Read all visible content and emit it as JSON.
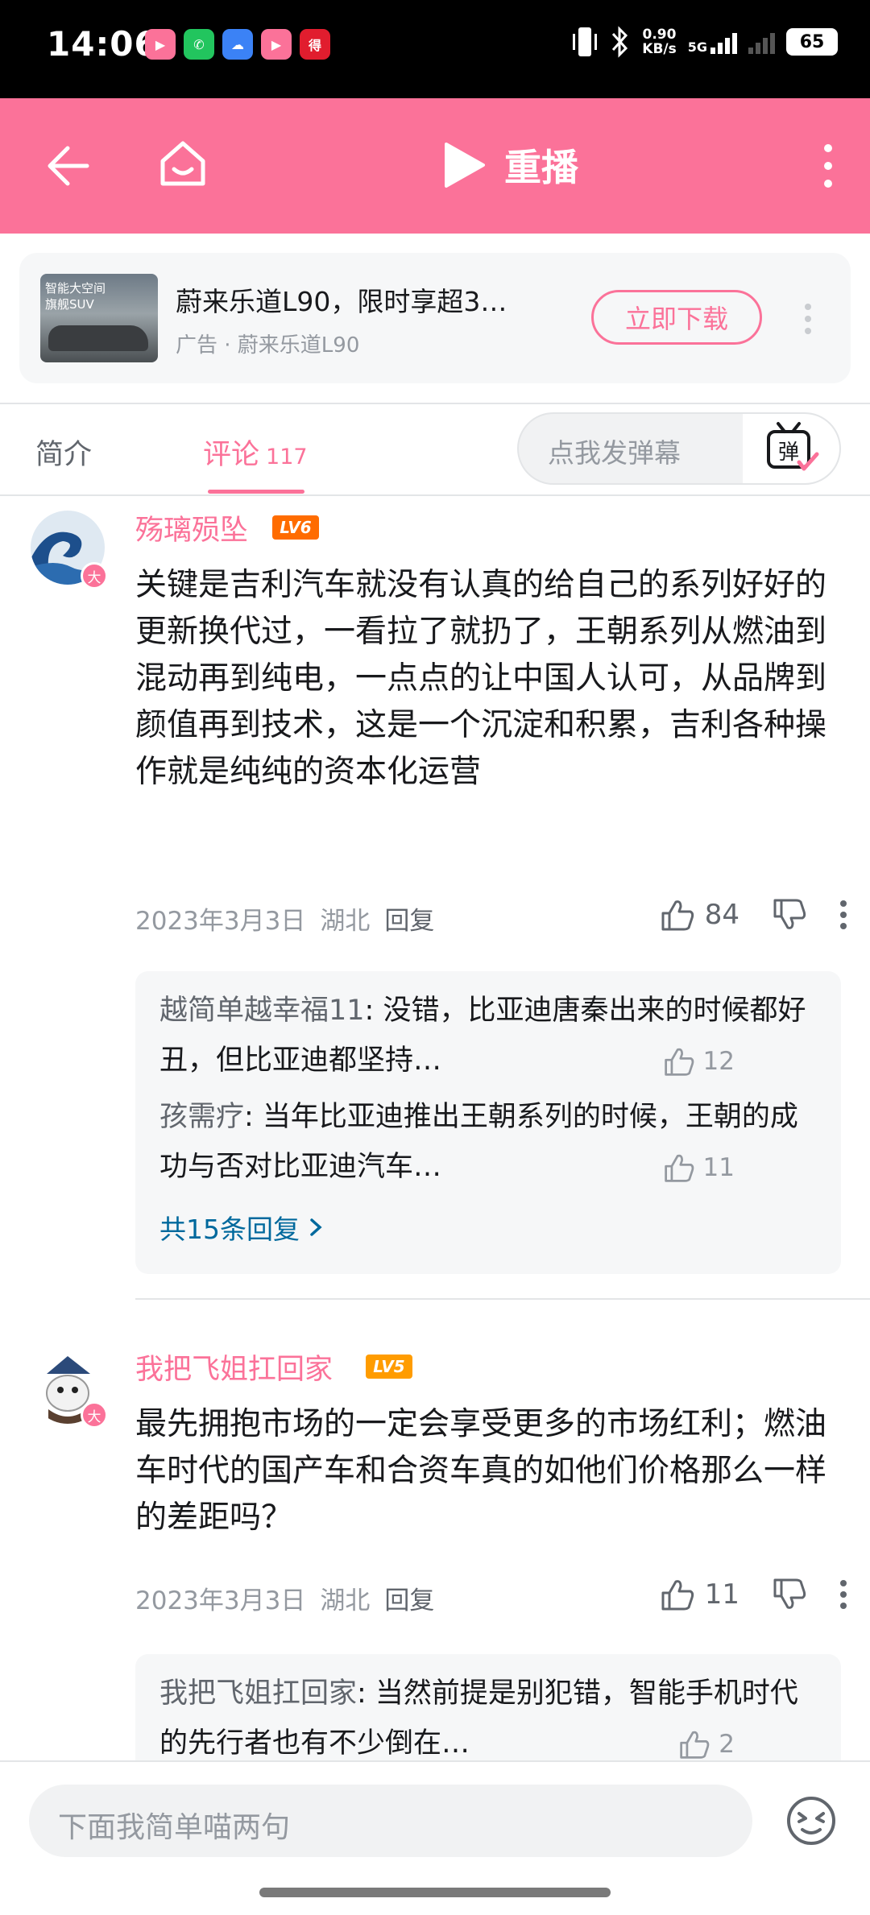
{
  "status_bar": {
    "time": "14:06",
    "net_speed_value": "0.90",
    "net_speed_unit": "KB/s",
    "network": "5G",
    "battery": "65",
    "app_icons": [
      "bilibili-icon",
      "phone-icon",
      "cloud-icon",
      "bilibili-icon",
      "dewu-icon"
    ]
  },
  "header": {
    "replay_label": "重播"
  },
  "ad": {
    "title": "蔚来乐道L90，限时享超3…",
    "subtitle": "广告 · 蔚来乐道L90",
    "button": "立即下载",
    "thumb_text_line1": "智能大空间",
    "thumb_text_line2": "旗舰SUV"
  },
  "tabs": {
    "intro": "简介",
    "comments": "评论",
    "comments_count": "117",
    "danmaku_placeholder": "点我发弹幕",
    "danmaku_icon_label": "弹"
  },
  "comments": [
    {
      "username": "殇璃殒坠",
      "level": "LV6",
      "vip_badge": "大",
      "text": "关键是吉利汽车就没有认真的给自己的系列好好的更新换代过，一看拉了就扔了，王朝系列从燃油到混动再到纯电，一点点的让中国人认可，从品牌到颜值再到技术，这是一个沉淀和积累，吉利各种操作就是纯纯的资本化运营",
      "date": "2023年3月3日",
      "location": "湖北",
      "reply_label": "回复",
      "likes": "84",
      "replies": [
        {
          "name": "越简单越幸福11",
          "text": ": 没错，比亚迪唐秦出来的时候都好丑，但比亚迪都坚持…",
          "likes": "12"
        },
        {
          "name": "孩需疗",
          "text": ": 当年比亚迪推出王朝系列的时候，王朝的成功与否对比亚迪汽车…",
          "likes": "11"
        }
      ],
      "more_replies": "共15条回复"
    },
    {
      "username": "我把飞姐扛回家",
      "level": "LV5",
      "vip_badge": "大",
      "text": "最先拥抱市场的一定会享受更多的市场红利；燃油车时代的国产车和合资车真的如他们价格那么一样的差距吗？",
      "date": "2023年3月3日",
      "location": "湖北",
      "reply_label": "回复",
      "likes": "11",
      "replies": [
        {
          "name": "我把飞姐扛回家",
          "text": ": 当然前提是别犯错，智能手机时代的先行者也有不少倒在…",
          "likes": "2"
        }
      ]
    }
  ],
  "bottom": {
    "input_placeholder": "下面我简单喵两句"
  },
  "colors": {
    "brand_pink": "#fb7299",
    "link_blue": "#00699d",
    "lv6": "#ff6c00",
    "lv5": "#ff9c00"
  }
}
